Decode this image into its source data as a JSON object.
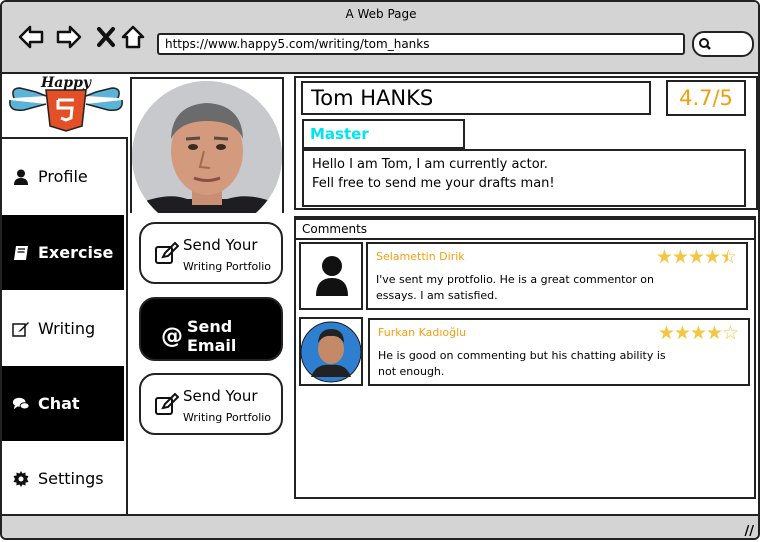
{
  "window": {
    "title": "A Web Page"
  },
  "browser": {
    "url": "https://www.happy5.com/writing/tom_hanks"
  },
  "logo": {
    "text": "Happy",
    "number": "5"
  },
  "sidebar": {
    "items": [
      {
        "label": "Profile",
        "icon": "user-icon"
      },
      {
        "label": "Exercise",
        "icon": "book-icon"
      },
      {
        "label": "Writing",
        "icon": "edit-icon"
      },
      {
        "label": "Chat",
        "icon": "chat-icon"
      },
      {
        "label": "Settings",
        "icon": "gear-icon"
      }
    ]
  },
  "actions": {
    "portfolio_1": {
      "line1": "Send Your",
      "line2": "Writing Portfolio"
    },
    "email": {
      "label": "Send Email"
    },
    "portfolio_2": {
      "line1": "Send Your",
      "line2": "Writing Portfolio"
    }
  },
  "profile": {
    "name": "Tom HANKS",
    "rating": "4.7/5",
    "level": "Master",
    "bio_line1": "Hello I am Tom, I am currently actor.",
    "bio_line2": "Fell free to send me your drafts man!"
  },
  "comments": {
    "header": "Comments",
    "items": [
      {
        "author": "Selamettin Dirik",
        "text": "I've sent my protfolio. He is a great commentor on essays. I am satisfied.",
        "stars": 4.5
      },
      {
        "author": "Furkan Kadıoğlu",
        "text": "He is good on commenting but his chatting ability is not enough.",
        "stars": 4
      }
    ]
  },
  "colors": {
    "accent_orange": "#f59e0b",
    "level_cyan": "#00e5ee",
    "star_gold": "#f5c542"
  }
}
